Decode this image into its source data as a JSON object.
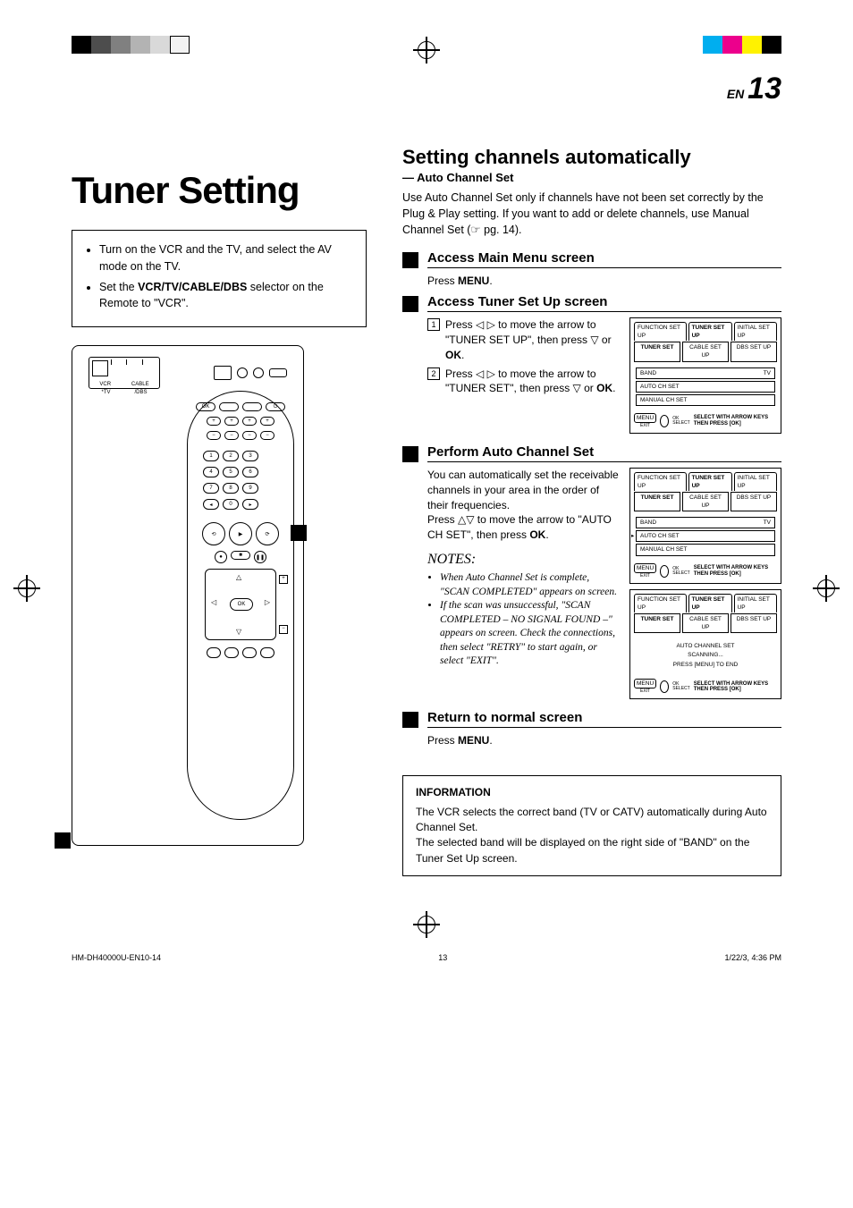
{
  "page": {
    "lang_prefix": "EN",
    "number": "13"
  },
  "title": "Tuner Setting",
  "intro": {
    "items": [
      "Turn on the VCR and the TV, and select the AV mode on the TV.",
      "Set the VCR/TV/CABLE/DBS selector on the Remote to \"VCR\"."
    ],
    "bold_in_1": "VCR/TV/CABLE/DBS"
  },
  "remote": {
    "slider_labels": [
      "VCR",
      "CABLE",
      "*TV",
      "/DBS"
    ],
    "ok": "OK",
    "numbers": [
      "1",
      "2",
      "3",
      "4",
      "5",
      "6",
      "7",
      "8",
      "9",
      "0"
    ]
  },
  "section": {
    "title": "Setting channels automatically",
    "subtitle": "— Auto Channel Set",
    "body": "Use Auto Channel Set only if channels have not been set correctly by the Plug & Play setting. If you want to add or delete channels, use Manual Channel Set (☞ pg. 14)."
  },
  "steps": [
    {
      "title": "Access Main Menu screen",
      "plain": "Press MENU.",
      "bold": "MENU"
    },
    {
      "title": "Access Tuner Set Up screen",
      "list": [
        "Press ◁ ▷ to move the arrow to \"TUNER SET UP\", then press ▽ or OK.",
        "Press ◁ ▷ to move the arrow to \"TUNER SET\", then press ▽ or OK."
      ],
      "osd": {
        "tabs": [
          "FUNCTION SET UP",
          "TUNER SET UP",
          "INITIAL SET UP"
        ],
        "active_tab": 1,
        "subtabs": [
          "TUNER SET",
          "CABLE SET UP",
          "DBS SET UP"
        ],
        "active_subtab": 0,
        "rows": [
          {
            "l": "BAND",
            "r": "TV"
          },
          {
            "l": "AUTO CH SET",
            "r": ""
          },
          {
            "l": "MANUAL CH SET",
            "r": ""
          }
        ],
        "footer": {
          "menu": "MENU",
          "exit": "EXIT",
          "ok": "OK",
          "select": "SELECT",
          "hint": "SELECT WITH ARROW KEYS THEN PRESS [OK]"
        }
      }
    },
    {
      "title": "Perform Auto Channel Set",
      "text": "You can automatically set the receivable channels in your area in the order of their frequencies.\nPress △▽ to move the arrow to \"AUTO CH SET\", then press OK.",
      "osd1": {
        "tabs": [
          "FUNCTION SET UP",
          "TUNER SET UP",
          "INITIAL SET UP"
        ],
        "active_tab": 1,
        "subtabs": [
          "TUNER SET",
          "CABLE SET UP",
          "DBS SET UP"
        ],
        "active_subtab": 0,
        "rows": [
          {
            "l": "BAND",
            "r": "TV"
          },
          {
            "l": "AUTO CH SET",
            "r": ""
          },
          {
            "l": "MANUAL CH SET",
            "r": ""
          }
        ],
        "footer": {
          "menu": "MENU",
          "exit": "EXIT",
          "ok": "OK",
          "select": "SELECT",
          "hint": "SELECT WITH ARROW KEYS THEN PRESS [OK]"
        }
      },
      "osd2": {
        "tabs": [
          "FUNCTION SET UP",
          "TUNER SET UP",
          "INITIAL SET UP"
        ],
        "active_tab": 1,
        "subtabs": [
          "TUNER SET",
          "CABLE SET UP",
          "DBS SET UP"
        ],
        "active_subtab": 0,
        "status": [
          "AUTO CHANNEL SET",
          "SCANNING...",
          "PRESS [MENU] TO END"
        ],
        "footer": {
          "menu": "MENU",
          "exit": "EXIT",
          "ok": "OK",
          "select": "SELECT",
          "hint": "SELECT WITH ARROW KEYS THEN PRESS [OK]"
        }
      },
      "notes_head": "NOTES:",
      "notes": [
        "When Auto Channel Set is complete, \"SCAN COMPLETED\" appears on screen.",
        "If the scan was unsuccessful, \"SCAN COMPLETED – NO SIGNAL FOUND –\" appears on screen. Check the connections, then select \"RETRY\" to start again, or select \"EXIT\"."
      ]
    },
    {
      "title": "Return to normal screen",
      "plain": "Press MENU.",
      "bold": "MENU"
    }
  ],
  "info": {
    "head": "INFORMATION",
    "body": "The VCR selects the correct band (TV or CATV) automatically during Auto Channel Set.\nThe selected band will be displayed on the right side of \"BAND\" on the Tuner Set Up screen."
  },
  "footer": {
    "file": "HM-DH40000U-EN10-14",
    "page": "13",
    "date": "1/22/3, 4:36 PM"
  },
  "color_bar": [
    "#000",
    "#333",
    "#555",
    "#888",
    "#aaa",
    "#ddd"
  ],
  "color_bar_r": [
    "#00aeef",
    "#ec008c",
    "#fff200",
    "#000"
  ]
}
